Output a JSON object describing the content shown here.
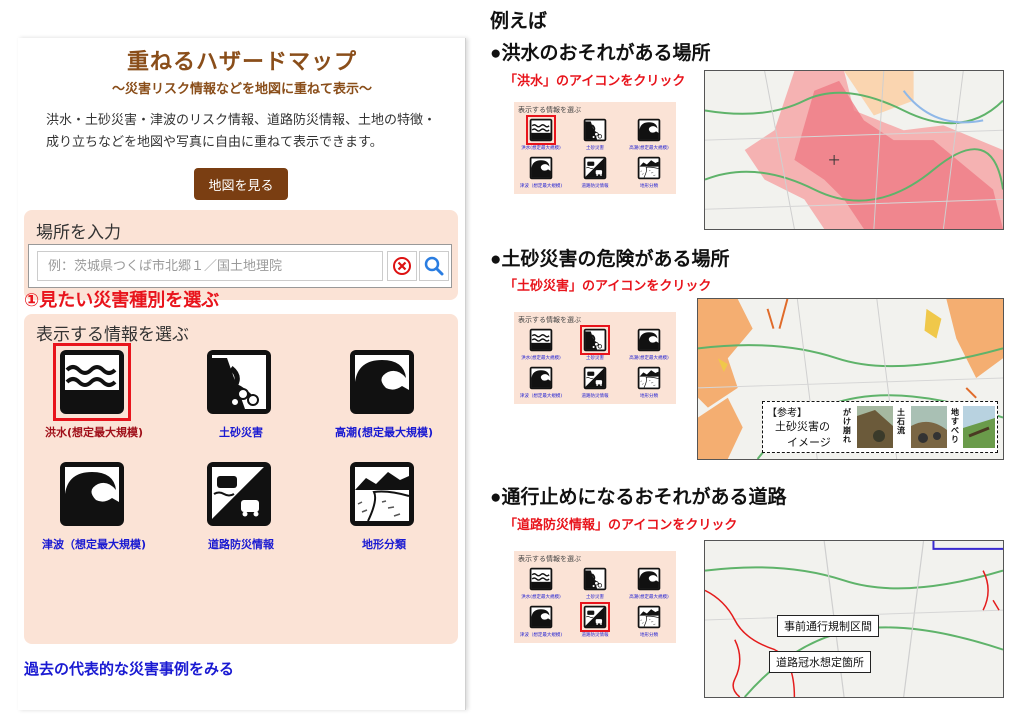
{
  "panel": {
    "title": "重ねるハザードマップ",
    "subtitle": "～災害リスク情報などを地図に重ねて表示～",
    "description": "洪水・土砂災害・津波のリスク情報、道路防災情報、土地の特徴・成り立ちなどを地図や写真に自由に重ねて表示できます。",
    "map_button": "地図を見る"
  },
  "location": {
    "heading": "場所を入力",
    "placeholder": "例：茨城県つくば市北郷１／国土地理院"
  },
  "step_label": "①見たい災害種別を選ぶ",
  "info": {
    "heading": "表示する情報を選ぶ",
    "items": [
      {
        "label": "洪水(想定最大規模)",
        "icon": "flood-icon",
        "selected": true
      },
      {
        "label": "土砂災害",
        "icon": "landslide-icon",
        "selected": false
      },
      {
        "label": "高潮(想定最大規模)",
        "icon": "storm-surge-icon",
        "selected": false
      },
      {
        "label": "津波（想定最大規模)",
        "icon": "tsunami-icon",
        "selected": false
      },
      {
        "label": "道路防災情報",
        "icon": "road-icon",
        "selected": false
      },
      {
        "label": "地形分類",
        "icon": "terrain-icon",
        "selected": false
      }
    ]
  },
  "past_link": "過去の代表的な災害事例をみる",
  "examples": {
    "title": "例えば",
    "sections": [
      {
        "heading": "●洪水のおそれがある場所",
        "instruction": "「洪水」のアイコンをクリック"
      },
      {
        "heading": "●土砂災害の危険がある場所",
        "instruction": "「土砂災害」のアイコンをクリック"
      },
      {
        "heading": "●通行止めになるおそれがある道路",
        "instruction": "「道路防災情報」のアイコンをクリック"
      }
    ],
    "mini_panel": {
      "heading": "表示する情報を選ぶ",
      "labels": [
        "洪水(想定最大規模)",
        "土砂災害",
        "高潮(想定最大規模)",
        "津波（想定最大規模)",
        "道路防災情報",
        "地形分類"
      ]
    },
    "sample": {
      "ref_label": "【参考】",
      "text1": "土砂災害の",
      "text2": "イメージ",
      "types": [
        "がけ崩れ",
        "土石流",
        "地すべり"
      ]
    },
    "callouts": [
      "事前通行規制区間",
      "道路冠水想定箇所"
    ]
  },
  "colors": {
    "brand": "#8a4e1a",
    "button": "#7a3e12",
    "panel_bg": "#fbe3d6",
    "highlight": "#e8141c",
    "link": "#1a1ad2"
  }
}
